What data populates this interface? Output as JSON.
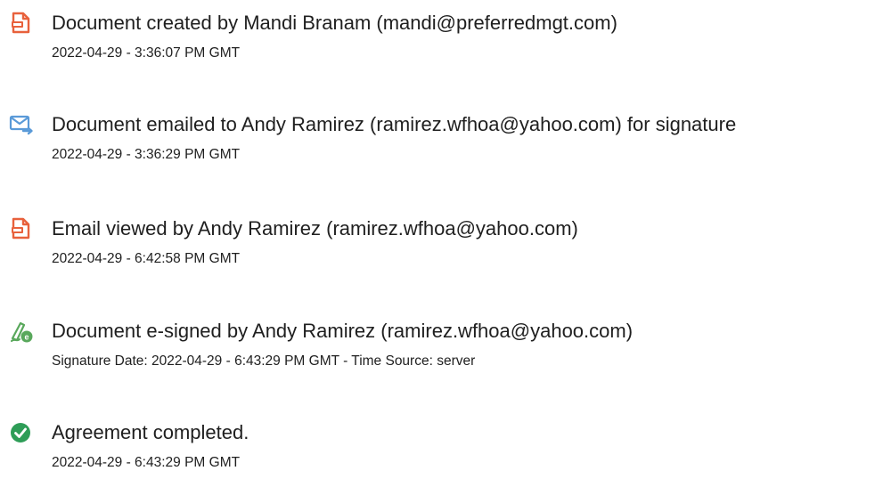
{
  "colors": {
    "doc_icon": "#e8613c",
    "mail_icon": "#5a9ad8",
    "sign_icon": "#59a85c",
    "check_icon": "#2e9d57",
    "text": "#1f1f1f"
  },
  "events": [
    {
      "icon": "document-icon",
      "title": "Document created by Mandi Branam (mandi@preferredmgt.com)",
      "detail": "2022-04-29 - 3:36:07 PM GMT"
    },
    {
      "icon": "email-sent-icon",
      "title": "Document emailed to Andy Ramirez (ramirez.wfhoa@yahoo.com) for signature",
      "detail": "2022-04-29 - 3:36:29 PM GMT"
    },
    {
      "icon": "document-icon",
      "title": "Email viewed by Andy Ramirez (ramirez.wfhoa@yahoo.com)",
      "detail": "2022-04-29 - 6:42:58 PM GMT"
    },
    {
      "icon": "e-sign-pen-icon",
      "title": "Document e-signed by Andy Ramirez (ramirez.wfhoa@yahoo.com)",
      "detail": "Signature Date: 2022-04-29 - 6:43:29 PM GMT - Time Source: server"
    },
    {
      "icon": "check-circle-icon",
      "title": "Agreement completed.",
      "detail": "2022-04-29 - 6:43:29 PM GMT"
    }
  ]
}
